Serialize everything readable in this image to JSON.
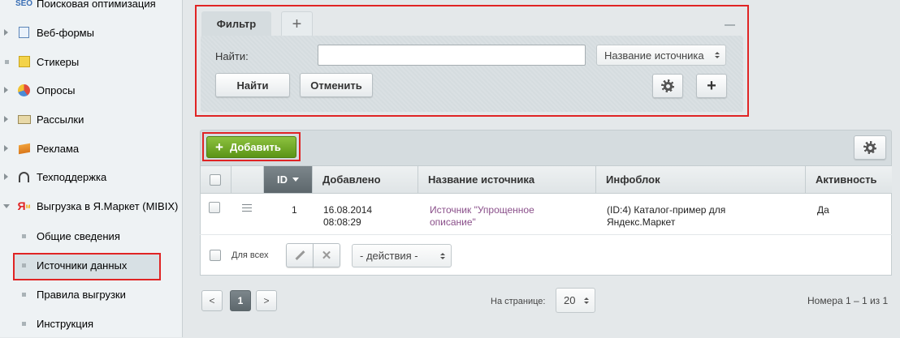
{
  "sidebar": {
    "items": [
      {
        "label": "Поисковая оптимизация",
        "icon": "seo-icon"
      },
      {
        "label": "Веб-формы",
        "icon": "webform-icon"
      },
      {
        "label": "Стикеры",
        "icon": "sticker-icon"
      },
      {
        "label": "Опросы",
        "icon": "poll-icon"
      },
      {
        "label": "Рассылки",
        "icon": "mail-icon"
      },
      {
        "label": "Реклама",
        "icon": "flag-icon"
      },
      {
        "label": "Техподдержка",
        "icon": "headset-icon"
      },
      {
        "label": "Выгрузка в Я.Маркет (MIBIX)",
        "icon": "yandex-market-icon"
      }
    ],
    "subitems": [
      {
        "label": "Общие сведения"
      },
      {
        "label": "Источники данных"
      },
      {
        "label": "Правила выгрузки"
      },
      {
        "label": "Инструкция"
      }
    ]
  },
  "filter": {
    "tab_label": "Фильтр",
    "add_tab": "+",
    "find_label": "Найти:",
    "search_value": "",
    "field_select": "Название источника",
    "find_button": "Найти",
    "cancel_button": "Отменить",
    "add_button": "+"
  },
  "toolbar": {
    "add_button": "Добавить",
    "add_icon": "+"
  },
  "table": {
    "columns": [
      "ID",
      "Добавлено",
      "Название источника",
      "Инфоблок",
      "Активность"
    ],
    "rows": [
      {
        "id": "1",
        "added_date": "16.08.2014",
        "added_time": "08:08:29",
        "name_line1": "Источник \"Упрощенное",
        "name_line2": "описание\"",
        "iblock_line1": "(ID:4) Каталог-пример для",
        "iblock_line2": "Яндекс.Маркет",
        "active": "Да"
      }
    ],
    "footer": {
      "for_all": "Для всех",
      "actions_select": "- действия -"
    }
  },
  "pagination": {
    "prev": "<",
    "current_page": "1",
    "next": ">",
    "per_page_label": "На странице:",
    "per_page_value": "20",
    "range_text": "Номера 1 – 1 из 1"
  },
  "colors": {
    "accent_green": "#6fa82a",
    "highlight_red": "#e02424",
    "link_purple": "#8a4f8a"
  }
}
